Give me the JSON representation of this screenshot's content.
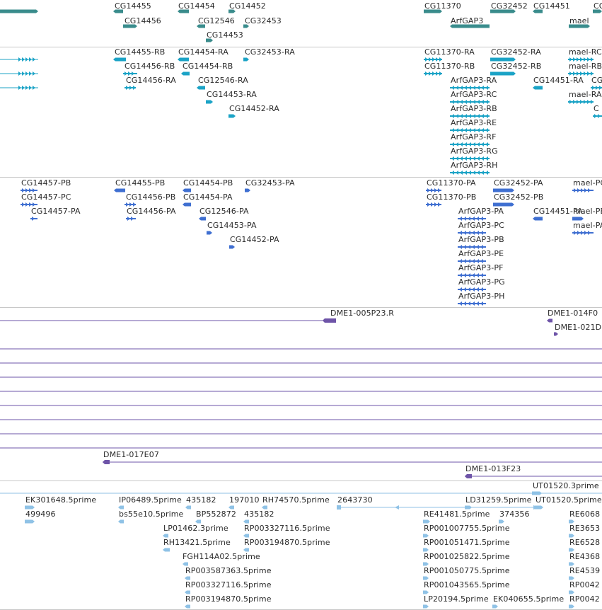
{
  "colors": {
    "gene": "#3a8c8c",
    "transcript_rna": "#1ba3c6",
    "transcript_protein": "#3f6fd1",
    "clone": "#6e54a8",
    "est": "#8fc2e6",
    "divider": "#c8c8c8",
    "label": "#2a2a2a"
  },
  "tracks": {
    "genes": {
      "features": [
        {
          "label": ""
        },
        {
          "label": "CG14455"
        },
        {
          "label": "CG14454"
        },
        {
          "label": "CG14452"
        },
        {
          "label": "CG14456"
        },
        {
          "label": "CG12546"
        },
        {
          "label": "CG32453"
        },
        {
          "label": "CG14453"
        },
        {
          "label": "CG11370"
        },
        {
          "label": "CG32452"
        },
        {
          "label": "CG14451"
        },
        {
          "label": "ArfGAP3"
        },
        {
          "label": "mael"
        },
        {
          "label": "CG"
        }
      ]
    },
    "transcripts_rna": {
      "features": [
        {
          "label": ""
        },
        {
          "label": ""
        },
        {
          "label": ""
        },
        {
          "label": "CG14455-RB"
        },
        {
          "label": "CG14454-RA"
        },
        {
          "label": "CG32453-RA"
        },
        {
          "label": "CG14456-RB"
        },
        {
          "label": "CG14454-RB"
        },
        {
          "label": "CG14456-RA"
        },
        {
          "label": "CG12546-RA"
        },
        {
          "label": "CG14453-RA"
        },
        {
          "label": "CG14452-RA"
        },
        {
          "label": "CG11370-RA"
        },
        {
          "label": "CG32452-RA"
        },
        {
          "label": "mael-RC"
        },
        {
          "label": "CG11370-RB"
        },
        {
          "label": "CG32452-RB"
        },
        {
          "label": "mael-RB"
        },
        {
          "label": "ArfGAP3-RA"
        },
        {
          "label": "CG14451-RA"
        },
        {
          "label": "CG"
        },
        {
          "label": "ArfGAP3-RC"
        },
        {
          "label": "mael-RA"
        },
        {
          "label": "ArfGAP3-RB"
        },
        {
          "label": "C"
        },
        {
          "label": "ArfGAP3-RE"
        },
        {
          "label": "ArfGAP3-RF"
        },
        {
          "label": "ArfGAP3-RG"
        },
        {
          "label": "ArfGAP3-RH"
        }
      ]
    },
    "transcripts_protein": {
      "features": [
        {
          "label": "CG14457-PB"
        },
        {
          "label": "CG14455-PB"
        },
        {
          "label": "CG14454-PB"
        },
        {
          "label": "CG32453-PA"
        },
        {
          "label": "CG14457-PC"
        },
        {
          "label": "CG14456-PB"
        },
        {
          "label": "CG14454-PA"
        },
        {
          "label": "CG14457-PA"
        },
        {
          "label": "CG14456-PA"
        },
        {
          "label": "CG12546-PA"
        },
        {
          "label": "CG14453-PA"
        },
        {
          "label": "CG14452-PA"
        },
        {
          "label": "CG11370-PA"
        },
        {
          "label": "CG32452-PA"
        },
        {
          "label": "mael-PC"
        },
        {
          "label": "CG11370-PB"
        },
        {
          "label": "CG32452-PB"
        },
        {
          "label": "mael-PB"
        },
        {
          "label": "ArfGAP3-PA"
        },
        {
          "label": "CG14451-PA"
        },
        {
          "label": "mael-PA"
        },
        {
          "label": "ArfGAP3-PC"
        },
        {
          "label": "ArfGAP3-PB"
        },
        {
          "label": "ArfGAP3-PE"
        },
        {
          "label": "ArfGAP3-PF"
        },
        {
          "label": "ArfGAP3-PG"
        },
        {
          "label": "ArfGAP3-PH"
        }
      ]
    },
    "clones": {
      "features": [
        {
          "label": "DME1-005P23.R"
        },
        {
          "label": "DME1-014F0"
        },
        {
          "label": "DME1-021D"
        },
        {
          "label": ""
        },
        {
          "label": ""
        },
        {
          "label": ""
        },
        {
          "label": ""
        },
        {
          "label": ""
        },
        {
          "label": ""
        },
        {
          "label": ""
        },
        {
          "label": ""
        },
        {
          "label": "DME1-017E07"
        },
        {
          "label": "DME1-013F23"
        }
      ]
    },
    "ests": {
      "features": [
        {
          "label": ""
        },
        {
          "label": "UT01520.3prime"
        },
        {
          "label": "EK301648.5prime"
        },
        {
          "label": "IP06489.5prime"
        },
        {
          "label": "435182"
        },
        {
          "label": "197010"
        },
        {
          "label": "RH74570.5prime"
        },
        {
          "label": "2643730"
        },
        {
          "label": ""
        },
        {
          "label": "LD31259.5prime"
        },
        {
          "label": "UT01520.5prime"
        },
        {
          "label": "499496"
        },
        {
          "label": "bs55e10.5prime"
        },
        {
          "label": "BP552872"
        },
        {
          "label": "435182"
        },
        {
          "label": "RE41481.5prime"
        },
        {
          "label": "374356"
        },
        {
          "label": "RE6068"
        },
        {
          "label": "LP01462.3prime"
        },
        {
          "label": "RP003327116.5prime"
        },
        {
          "label": "RP001007755.5prime"
        },
        {
          "label": "RE3653"
        },
        {
          "label": "RH13421.5prime"
        },
        {
          "label": "RP003194870.5prime"
        },
        {
          "label": "RP001051471.5prime"
        },
        {
          "label": "RE6528"
        },
        {
          "label": "FGH114A02.5prime"
        },
        {
          "label": "RP001025822.5prime"
        },
        {
          "label": "RE4368"
        },
        {
          "label": "RP003587363.5prime"
        },
        {
          "label": "RP001050775.5prime"
        },
        {
          "label": "RE4539"
        },
        {
          "label": "RP003327116.5prime"
        },
        {
          "label": "RP001043565.5prime"
        },
        {
          "label": "RP0042"
        },
        {
          "label": "RP003194870.5prime"
        },
        {
          "label": "LP20194.5prime"
        },
        {
          "label": "EK040655.5prime"
        },
        {
          "label": "RP0042"
        }
      ]
    }
  }
}
